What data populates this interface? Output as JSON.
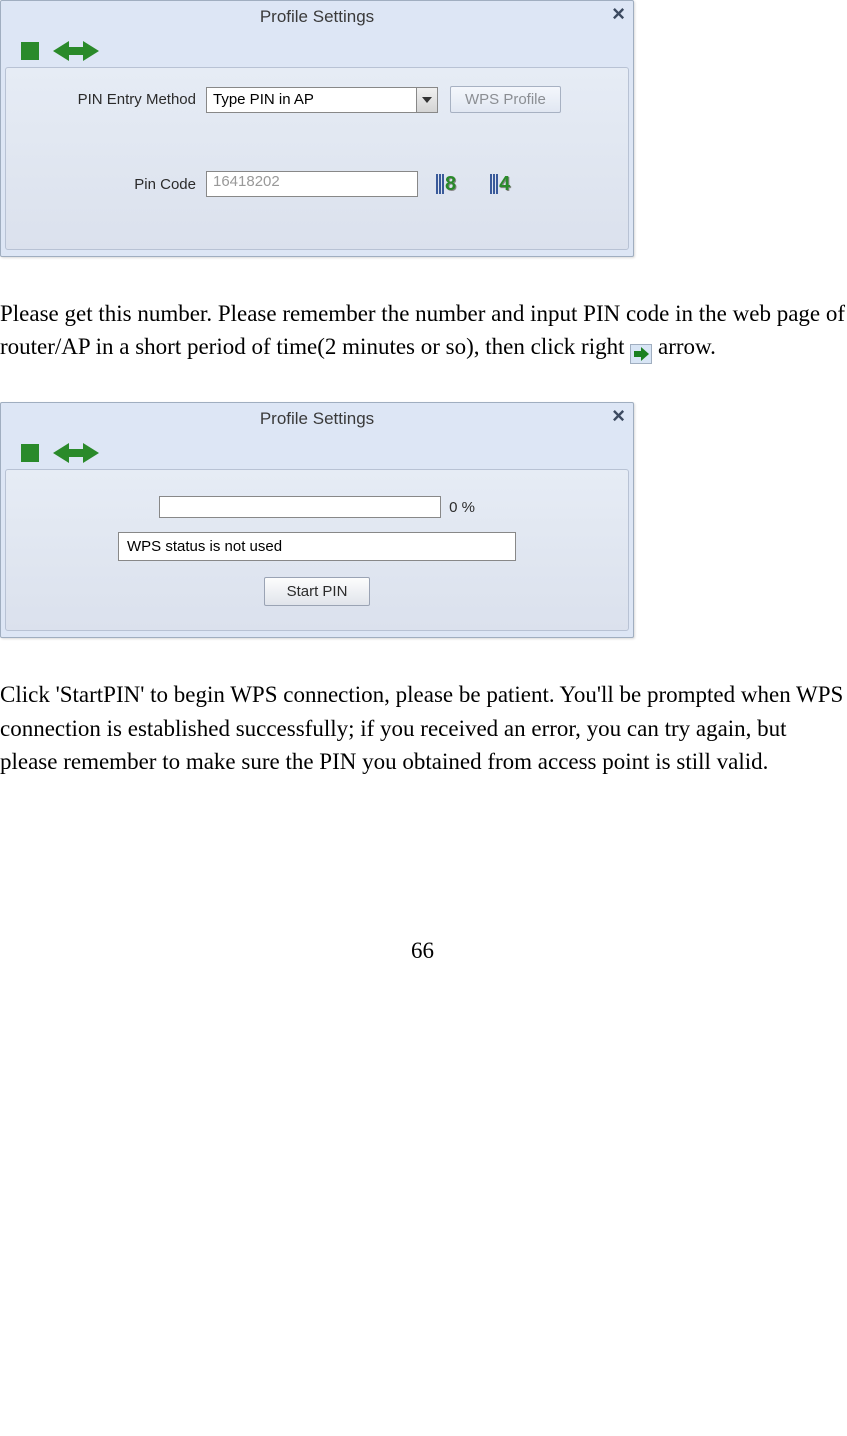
{
  "dialog1": {
    "title": "Profile Settings",
    "close_glyph": "×",
    "pin_entry_label": "PIN Entry Method",
    "pin_entry_value": "Type PIN in AP",
    "wps_profile_btn": "WPS Profile",
    "pin_code_label": "Pin Code",
    "pin_code_value": "16418202",
    "icon8_digit": "8",
    "icon4_digit": "4"
  },
  "para1_a": "Please get this number. Please remember the number and input PIN code in the web page of router/AP in a short period of time(2 minutes or so), then click right ",
  "para1_b": " arrow.",
  "dialog2": {
    "title": "Profile Settings",
    "close_glyph": "×",
    "progress_pct": "0 %",
    "status_text": "WPS status is not used",
    "start_btn": "Start PIN"
  },
  "para2": "Click 'StartPIN' to begin WPS connection, please be patient. You'll be prompted when WPS connection is established successfully; if you received an error, you can try again, but please remember to make sure the PIN you obtained from access point is still valid.",
  "page_number": "66"
}
